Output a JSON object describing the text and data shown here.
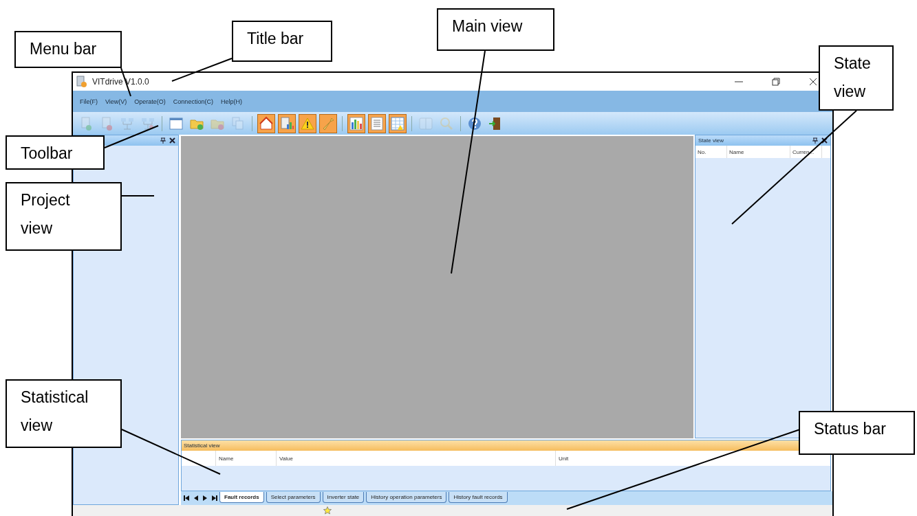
{
  "window": {
    "title": "VITdrive V1.0.0"
  },
  "menu": [
    "File(F)",
    "View(V)",
    "Operate(O)",
    "Connection(C)",
    "Help(H)"
  ],
  "toolbar": {
    "groups": [
      [
        {
          "on": false,
          "disabled": true
        },
        {
          "on": false,
          "disabled": true
        },
        {
          "on": false,
          "disabled": true
        },
        {
          "on": false,
          "disabled": true
        }
      ],
      [
        {
          "on": false,
          "disabled": false
        },
        {
          "on": false,
          "disabled": false
        },
        {
          "on": false,
          "disabled": true
        },
        {
          "on": false,
          "disabled": true
        }
      ],
      [
        {
          "on": true,
          "disabled": false
        },
        {
          "on": true,
          "disabled": false
        },
        {
          "on": true,
          "disabled": false
        },
        {
          "on": true,
          "disabled": false
        }
      ],
      [
        {
          "on": true,
          "disabled": false
        },
        {
          "on": true,
          "disabled": false
        },
        {
          "on": true,
          "disabled": false
        }
      ],
      [
        {
          "on": false,
          "disabled": true
        },
        {
          "on": false,
          "disabled": true
        }
      ],
      [
        {
          "on": false,
          "disabled": false
        },
        {
          "on": false,
          "disabled": false
        }
      ]
    ]
  },
  "state_view": {
    "title": "State view",
    "columns": [
      "No.",
      "Name",
      "Curren..."
    ]
  },
  "statistical_view": {
    "title": "Statistical view",
    "columns": [
      "Name",
      "Value",
      "Unit"
    ]
  },
  "tabs": [
    {
      "label": "Fault records",
      "selected": true
    },
    {
      "label": "Select parameters",
      "selected": false
    },
    {
      "label": "Inverter state",
      "selected": false
    },
    {
      "label": "History operation parameters",
      "selected": false
    },
    {
      "label": "History fault records",
      "selected": false
    }
  ],
  "callouts": [
    {
      "label": "Menu bar"
    },
    {
      "label": "Title bar"
    },
    {
      "label": "Main view"
    },
    {
      "label": "State view"
    },
    {
      "label": "Toolbar"
    },
    {
      "label": "Project view"
    },
    {
      "label": "Statistical view"
    },
    {
      "label": "Status bar"
    }
  ]
}
